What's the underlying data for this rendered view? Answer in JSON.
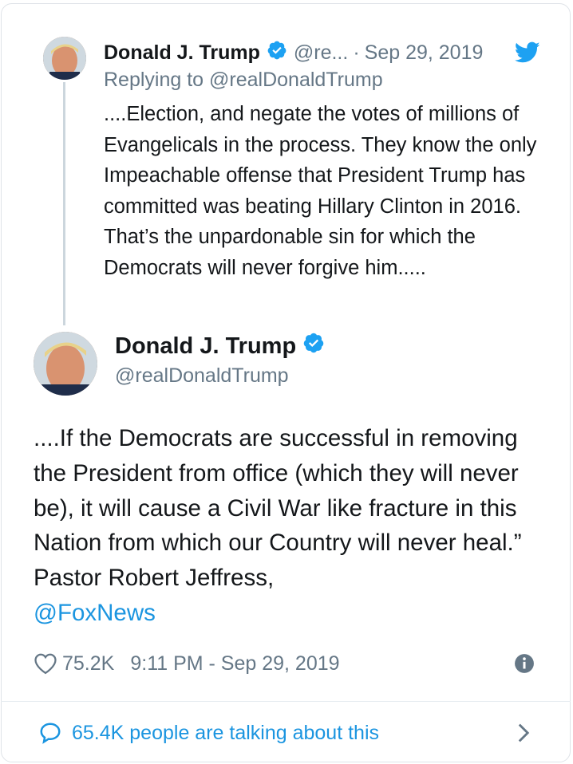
{
  "reply_tweet": {
    "author_name": "Donald J. Trump",
    "handle_truncated": "@re...",
    "separator": "·",
    "date": "Sep 29, 2019",
    "replying_to": "Replying to @realDonaldTrump",
    "text": "....Election, and negate the votes of millions of Evangelicals in the process. They know the only Impeachable offense that President Trump has committed was beating Hillary Clinton in 2016. That’s the unpardonable sin for which the Democrats will never forgive him....."
  },
  "main_tweet": {
    "author_name": "Donald J. Trump",
    "handle": "@realDonaldTrump",
    "text": "....If the Democrats are successful in removing the President from office (which they will never be), it will cause a Civil War like fracture in this Nation from which our Country will never heal.” Pastor Robert Jeffress,",
    "mention": "@FoxNews",
    "likes": "75.2K",
    "timestamp": "9:11 PM - Sep 29, 2019"
  },
  "footer": {
    "talking": "65.4K people are talking about this"
  },
  "icons": {
    "verified": "verified-badge-icon",
    "bird": "twitter-bird-icon",
    "heart": "heart-icon",
    "info": "info-icon",
    "bubble": "speech-bubble-icon",
    "chevron": "chevron-right-icon"
  },
  "colors": {
    "accent": "#1b95e0",
    "secondary_text": "#657786",
    "primary_text": "#14171a",
    "verified": "#1da1f2",
    "thread_line": "#ccd6dd"
  }
}
